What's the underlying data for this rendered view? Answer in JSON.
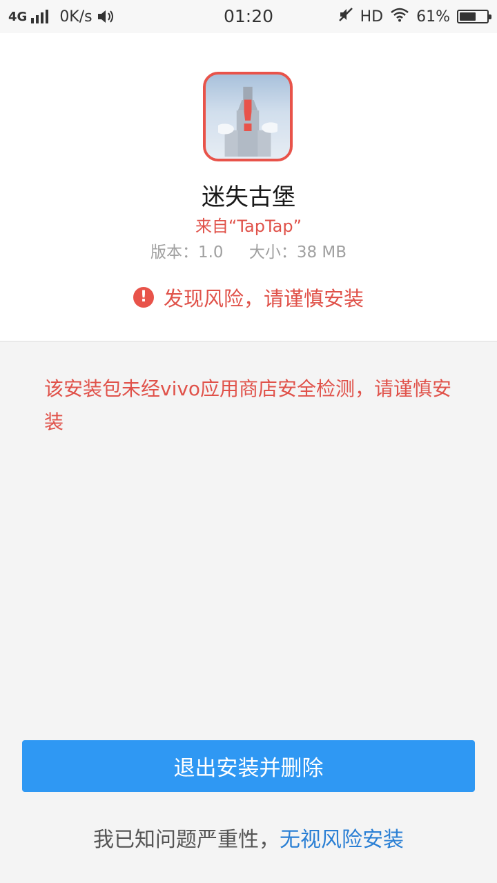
{
  "status_bar": {
    "network": "4G",
    "speed": "0K/s",
    "time": "01:20",
    "hd": "HD",
    "battery": "61%",
    "battery_level": 0.61,
    "icons": [
      "signal-icon",
      "speaker-icon",
      "muted-icon",
      "wifi-icon",
      "battery-icon"
    ]
  },
  "app": {
    "name": "迷失古堡",
    "source": "来自“TapTap”",
    "version": "版本：1.0",
    "size": "大小：38 MB",
    "icon": "castle-app-icon",
    "overlay_symbol": "!"
  },
  "risk": {
    "icon": "warning-circle-icon",
    "symbol": "!",
    "message": "发现风险，请谨慎安装"
  },
  "warning_detail": "该安装包未经vivo应用商店安全检测，请谨慎安装",
  "actions": {
    "exit_label": "退出安装并删除",
    "notice_prefix": "我已知问题严重性，",
    "ignore_label": "无视风险安装"
  },
  "colors": {
    "accent_red": "#e0524a",
    "button_blue": "#2f98f3",
    "link_blue": "#2a7fd4"
  }
}
